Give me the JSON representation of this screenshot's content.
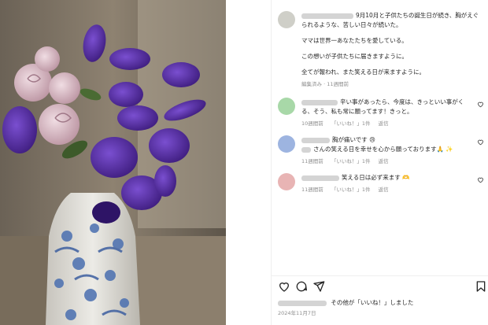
{
  "post": {
    "caption_lines": [
      "9月10月と子供たちの誕生日が続き、胸がえぐられるような、苦しい日々が続いた。",
      "ママは世界一あなたたちを愛している。",
      "この想いが子供たちに届きますように。",
      "全てが報われ、また笑える日が来ますように。"
    ],
    "caption_meta": "編集済み · 11週間前"
  },
  "comments": [
    {
      "lines": [
        "辛い事があったら、今度は、きっといい事がく",
        "る、そう、私も常に願ってます！きっと。"
      ],
      "time": "10週間前",
      "likes": "「いいね！」1件",
      "reply": "返信",
      "avatar_color": "#a8d8a8"
    },
    {
      "lines": [
        "胸が痛いです 😢",
        "さんの笑える日を幸せを心から願っております🙏 ✨"
      ],
      "time": "11週間前",
      "likes": "「いいね！」1件",
      "reply": "返信",
      "avatar_color": "#9db4e0"
    },
    {
      "lines": [
        "笑える日は必ず来ます 🫶"
      ],
      "time": "11週間前",
      "likes": "「いいね！」1件",
      "reply": "返信",
      "avatar_color": "#e8b4b4"
    }
  ],
  "actions": {
    "like_icon": "heart-icon",
    "comment_icon": "comment-icon",
    "share_icon": "send-icon",
    "save_icon": "bookmark-icon"
  },
  "likes_text": "その他が「いいね！」しました",
  "likes_bold": "その他",
  "date": "2024年11月7日",
  "colors": {
    "meta_gray": "#8e8e8e",
    "orchid": "#5a2aa8",
    "rose": "#d9b8c4"
  }
}
